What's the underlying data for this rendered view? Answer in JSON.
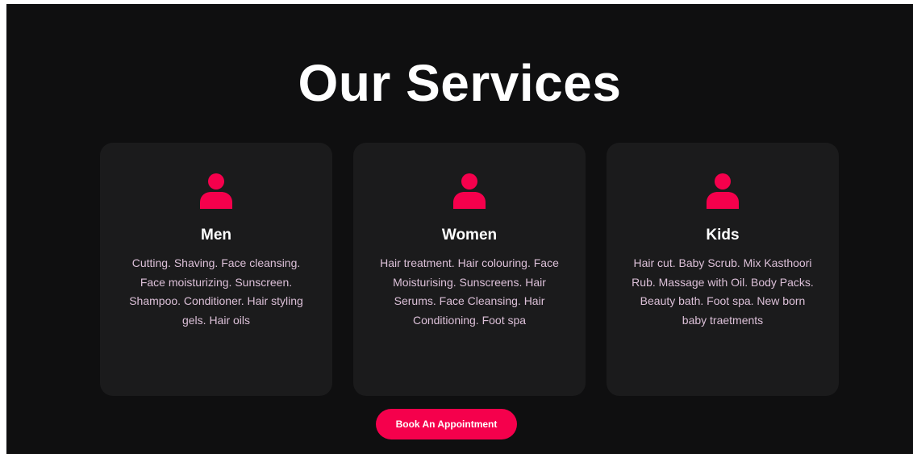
{
  "section": {
    "title": "Our Services"
  },
  "services": [
    {
      "title": "Men",
      "description": "Cutting. Shaving. Face cleansing. Face moisturizing. Sunscreen. Shampoo. Conditioner. Hair styling gels. Hair oils",
      "icon": "user-icon"
    },
    {
      "title": "Women",
      "description": "Hair treatment. Hair colouring. Face Moisturising. Sunscreens. Hair Serums. Face Cleansing. Hair Conditioning. Foot spa",
      "icon": "user-icon"
    },
    {
      "title": "Kids",
      "description": "Hair cut. Baby Scrub. Mix Kasthoori Rub. Massage with Oil. Body Packs. Beauty bath. Foot spa. New born baby traetments",
      "icon": "user-icon"
    }
  ],
  "cta": {
    "label": "Book An Appointment"
  },
  "colors": {
    "background": "#0f0f10",
    "card": "#1b1b1c",
    "accent": "#f5004c",
    "body_text": "#dcc0d8",
    "heading": "#ffffff"
  }
}
